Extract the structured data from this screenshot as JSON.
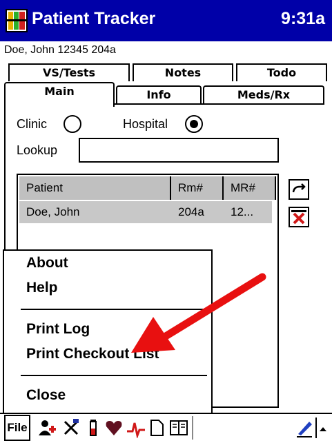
{
  "titlebar": {
    "app_title": "Patient Tracker",
    "time": "9:31a",
    "app_icon": "patient-tracker-app-icon"
  },
  "patient_header": "Doe, John 12345 204a",
  "tabs": [
    {
      "label": "VS/Tests"
    },
    {
      "label": "Notes"
    },
    {
      "label": "Todo"
    },
    {
      "label": "Main",
      "selected": true
    },
    {
      "label": "Info"
    },
    {
      "label": "Meds/Rx"
    }
  ],
  "location": {
    "clinic_label": "Clinic",
    "hospital_label": "Hospital",
    "selected": "Hospital"
  },
  "lookup": {
    "label": "Lookup",
    "value": ""
  },
  "patient_table": {
    "columns": [
      "Patient",
      "Rm#",
      "MR#"
    ],
    "rows": [
      {
        "patient": "Doe, John",
        "room": "204a",
        "mr": "12..."
      }
    ]
  },
  "side_buttons": [
    "refresh-icon",
    "delete-x-icon"
  ],
  "file_menu": {
    "items": [
      {
        "label": "About"
      },
      {
        "label": "Help"
      },
      {
        "label": "Print Log"
      },
      {
        "label": "Print Checkout List"
      },
      {
        "label": "Close"
      }
    ]
  },
  "bottombar": {
    "file_label": "File",
    "toolbar_icons": [
      "patient-add-icon",
      "procedure-icon",
      "test-tube-icon",
      "heart-icon",
      "vitals-icon",
      "note-icon",
      "book-icon",
      "pen-icon",
      "up-arrow-icon"
    ]
  },
  "colors": {
    "titlebar": "#0000a8",
    "selection": "#c8c8c8",
    "arrow": "#e81010"
  }
}
